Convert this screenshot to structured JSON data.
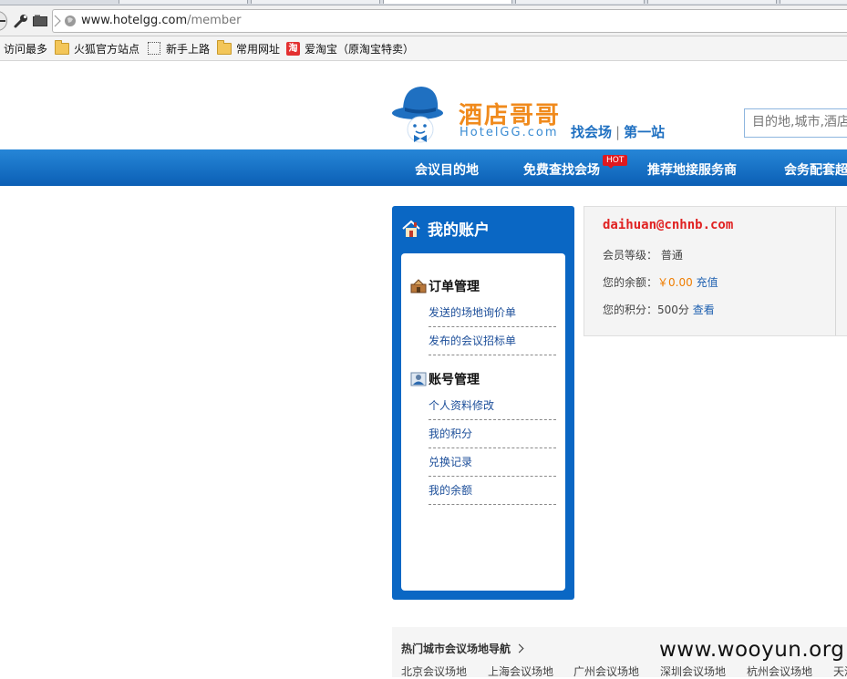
{
  "browser": {
    "url_host": "www.hotelgg.com",
    "url_path": "/member",
    "bookmarks": [
      {
        "label": "访问最多",
        "icon": "none"
      },
      {
        "label": "火狐官方站点",
        "icon": "folder-icon"
      },
      {
        "label": "新手上路",
        "icon": "dotted-icon"
      },
      {
        "label": "常用网址",
        "icon": "folder-icon"
      },
      {
        "label": "爱淘宝（原淘宝特卖）",
        "icon": "taobao-icon",
        "icon_char": "淘"
      }
    ]
  },
  "site": {
    "logo_cn": "酒店哥哥",
    "logo_en": "HotelGG.com",
    "tagline_a": "找会场",
    "tagline_sep": "|",
    "tagline_b": "第一站",
    "search_placeholder": "目的地,城市,酒店"
  },
  "nav": {
    "items": [
      "会议目的地",
      "免费查找会场",
      "推荐地接服务商",
      "会务配套超"
    ],
    "hot_badge": "HOT"
  },
  "sidebar": {
    "title": "我的账户",
    "sections": [
      {
        "title": "订单管理",
        "links": [
          "发送的场地询价单",
          "发布的会议招标单"
        ]
      },
      {
        "title": "账号管理",
        "links": [
          "个人资料修改",
          "我的积分",
          "兑换记录",
          "我的余额"
        ]
      }
    ]
  },
  "account": {
    "email": "daihuan@cnhnb.com",
    "level_label": "会员等级：",
    "level_value": "普通",
    "balance_label": "您的余额：",
    "balance_value": "￥0.00",
    "recharge_link": "充值",
    "points_label": "您的积分：",
    "points_value": "500分",
    "view_link": "查看"
  },
  "hot_cities": {
    "title": "热门城市会议场地导航",
    "cities": [
      "北京会议场地",
      "上海会议场地",
      "广州会议场地",
      "深圳会议场地",
      "杭州会议场地",
      "天津"
    ]
  },
  "watermark": "www.wooyun.org",
  "colors": {
    "nav_blue": "#0b5fb5",
    "logo_orange": "#f08a1c",
    "email_red": "#e02222",
    "link_blue": "#1d4f9a",
    "hot_red": "#e0191f"
  }
}
